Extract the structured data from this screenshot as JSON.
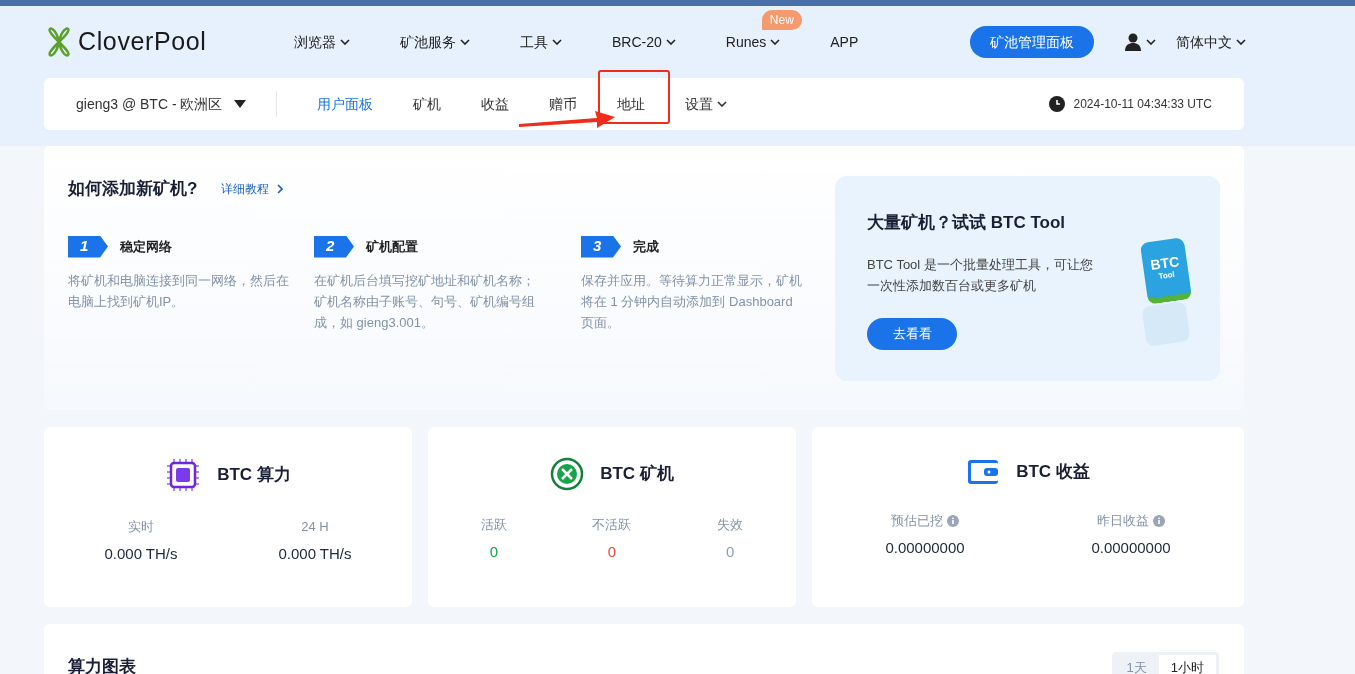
{
  "header": {
    "logo": "CloverPool",
    "nav": [
      {
        "label": "浏览器",
        "dropdown": true
      },
      {
        "label": "矿池服务",
        "dropdown": true
      },
      {
        "label": "工具",
        "dropdown": true
      },
      {
        "label": "BRC-20",
        "dropdown": true
      },
      {
        "label": "Runes",
        "dropdown": true,
        "badge": "New"
      },
      {
        "label": "APP",
        "dropdown": false
      }
    ],
    "cta": "矿池管理面板",
    "language": "简体中文"
  },
  "subnav": {
    "account": "gieng3 @ BTC - 欧洲区",
    "tabs": [
      {
        "label": "用户面板",
        "selected": true,
        "dropdown": false,
        "highlighted": false
      },
      {
        "label": "矿机",
        "selected": false,
        "dropdown": false,
        "highlighted": false
      },
      {
        "label": "收益",
        "selected": false,
        "dropdown": false,
        "highlighted": false
      },
      {
        "label": "赠币",
        "selected": false,
        "dropdown": false,
        "highlighted": false
      },
      {
        "label": "地址",
        "selected": false,
        "dropdown": false,
        "highlighted": true
      },
      {
        "label": "设置",
        "selected": false,
        "dropdown": true,
        "highlighted": false
      }
    ],
    "time": "2024-10-11 04:34:33 UTC"
  },
  "guide": {
    "title": "如何添加新矿机?",
    "link": "详细教程",
    "steps": [
      {
        "number": "1",
        "title": "稳定网络",
        "text": "将矿机和电脑连接到同一网络，然后在电脑上找到矿机IP。"
      },
      {
        "number": "2",
        "title": "矿机配置",
        "text": "在矿机后台填写挖矿地址和矿机名称；矿机名称由子账号、句号、矿机编号组成，如 gieng3.001。"
      },
      {
        "number": "3",
        "title": "完成",
        "text": "保存并应用。等待算力正常显示，矿机将在 1 分钟内自动添加到 Dashboard 页面。"
      }
    ],
    "promo": {
      "title": "大量矿机？试试 BTC Tool",
      "text": "BTC Tool 是一个批量处理工具，可让您一次性添加数百台或更多矿机",
      "button": "去看看",
      "icon_text": "BTC",
      "icon_subtext": "Tool"
    }
  },
  "stats": [
    {
      "kind": "hashrate",
      "title": "BTC 算力",
      "items": [
        {
          "label": "实时",
          "value": "0.000 TH/s",
          "info": false,
          "color": "#1f2937"
        },
        {
          "label": "24 H",
          "value": "0.000 TH/s",
          "info": false,
          "color": "#1f2937"
        }
      ]
    },
    {
      "kind": "miners",
      "title": "BTC 矿机",
      "items": [
        {
          "label": "活跃",
          "value": "0",
          "info": false,
          "color": "#16a34a"
        },
        {
          "label": "不活跃",
          "value": "0",
          "info": false,
          "color": "#ef4444"
        },
        {
          "label": "失效",
          "value": "0",
          "info": false,
          "color": "#8aa0b8"
        }
      ]
    },
    {
      "kind": "earnings",
      "title": "BTC 收益",
      "items": [
        {
          "label": "预估已挖",
          "value": "0.00000000",
          "info": true,
          "color": "#1f2937"
        },
        {
          "label": "昨日收益",
          "value": "0.00000000",
          "info": true,
          "color": "#1f2937"
        }
      ]
    }
  ],
  "chart_panel": {
    "title": "算力图表",
    "ranges": [
      {
        "label": "1天",
        "selected": false
      },
      {
        "label": "1小时",
        "selected": true
      }
    ]
  }
}
